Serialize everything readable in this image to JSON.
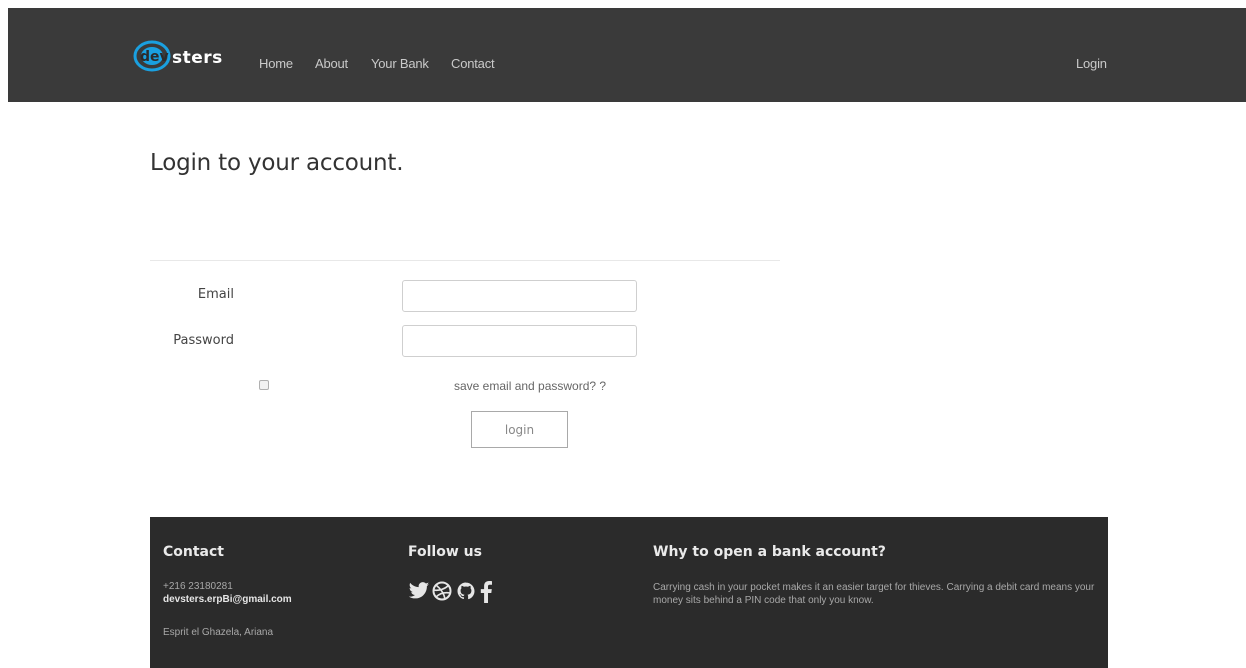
{
  "nav": {
    "brand": "devsters",
    "links": [
      "Home",
      "About",
      "Your Bank",
      "Contact"
    ],
    "login": "Login"
  },
  "main": {
    "title": "Login to your account.",
    "email_label": "Email",
    "email_value": "",
    "password_label": "Password",
    "password_value": "",
    "remember_label": "save email and password? ?",
    "remember_checked": false,
    "login_button": "login"
  },
  "footer": {
    "contact_heading": "Contact",
    "phone": "+216 23180281",
    "email": "devsters.erpBi@gmail.com",
    "address": "Esprit el Ghazela, Ariana",
    "follow_heading": "Follow us",
    "social_icons": [
      "twitter-icon",
      "dribbble-icon",
      "github-icon",
      "facebook-icon"
    ],
    "why_heading": "Why to open a bank account?",
    "why_text": "Carrying cash in your pocket makes it an easier target for thieves. Carrying a debit card means your money sits behind a PIN code that only you know."
  },
  "colors": {
    "navbar_bg": "#3a3a3a",
    "footer_bg": "#2b2b2b",
    "logo_blue": "#1aa0e0"
  }
}
